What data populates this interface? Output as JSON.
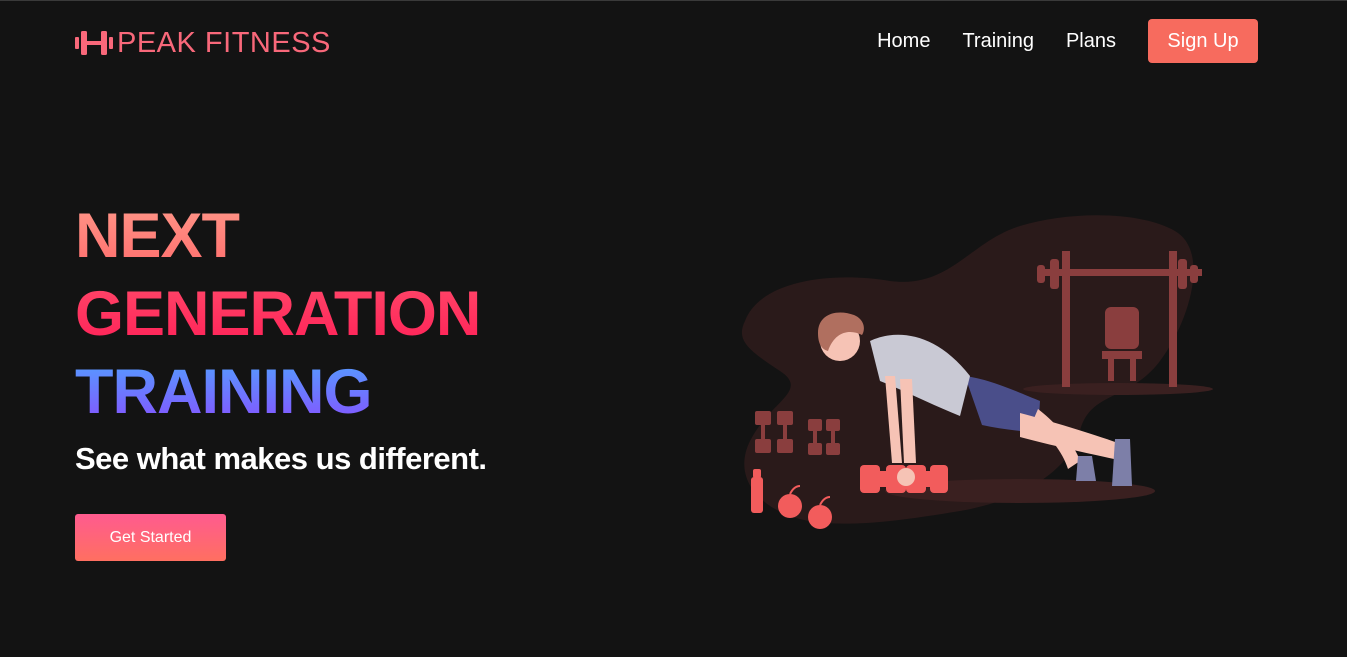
{
  "brand": {
    "name": "PEAK FITNESS",
    "icon": "dumbbell-icon",
    "color": "#f8687a"
  },
  "nav": {
    "links": [
      "Home",
      "Training",
      "Plans"
    ],
    "signup_label": "Sign Up",
    "signup_color": "#f76b5e"
  },
  "hero": {
    "title_line1": "NEXT",
    "title_line2": "GENERATION",
    "title_line3": "TRAINING",
    "subtitle": "See what makes us different.",
    "cta_label": "Get Started"
  },
  "illustration": {
    "subject": "person-pushup-illustration"
  },
  "colors": {
    "background": "#131313",
    "accent": "#f76b5e",
    "title_pink": "#ff1e56",
    "title_blue": "#4fa5ff",
    "title_purple": "#8a4bff"
  }
}
